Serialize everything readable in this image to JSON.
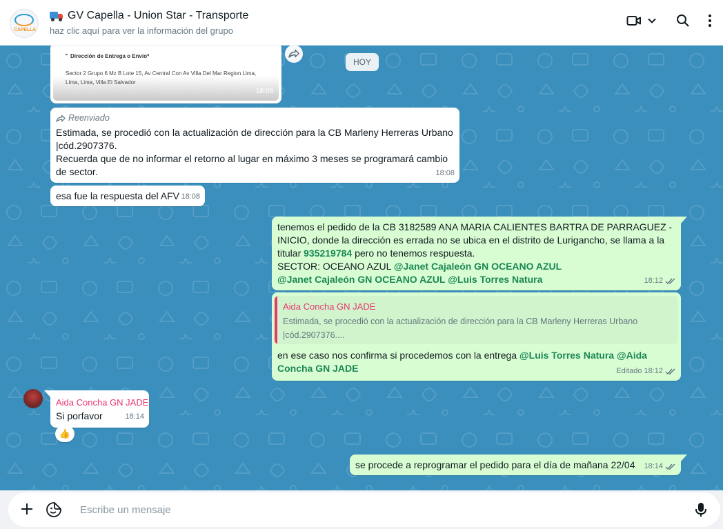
{
  "header": {
    "logo_text": "CAPELLA",
    "title": "GV Capella - Union Star - Transporte",
    "subtitle": "haz clic aquí para ver la información del grupo",
    "icons": [
      "video-call-icon",
      "chevron-down-icon",
      "search-icon",
      "menu-dots-icon"
    ]
  },
  "chat": {
    "image_message": {
      "section_heading": "Dirección de Entrega o Envío*",
      "address": "Sector 2 Grupo 6 Mz B Lote 15, Av Central Con Av Villa Del Mar Region Lima, Lima, Lima, Villa El Salvador",
      "time": "18:08"
    },
    "day_label": "HOY",
    "forwarded_message": {
      "forwarded_label": "Reenviado",
      "line1": "Estimada, se procedió con la actualización de dirección para la CB Marleny Herreras Urbano",
      "line2": "|cód.2907376.",
      "line3": "Recuerda que de no informar el retorno al lugar en máximo 3 meses se programará cambio",
      "line4": "de sector.",
      "time": "18:08"
    },
    "afv_message": {
      "text": "esa fue la respuesta del AFV",
      "time": "18:08"
    },
    "out_message_1": {
      "line1": "tenemos el pedido de la CB 3182589 ANA MARIA CALIENTES BARTRA DE PARRAGUEZ -",
      "line2": "INICIO, donde la dirección es errada no se ubica en el distrito de Lurigancho, se llama a la",
      "line3_pre": "titular ",
      "phone": "935219784",
      "line3_post": " pero no tenemos respuesta.",
      "line4_pre": "SECTOR: OCEANO AZUL ",
      "mention_1": "@Janet Cajaleón GN OCEANO AZUL",
      "mention_2": "@Janet Cajaleón GN OCEANO AZUL",
      "mention_3": "@Luis Torres Natura",
      "time": "18:12"
    },
    "out_message_2": {
      "quote_name": "Aida Concha GN JADE",
      "quote_line1": "Estimada, se procedió con la actualización de dirección para la CB Marleny Herreras Urbano",
      "quote_line2": "|cód.2907376....",
      "text_pre": "en ese caso nos confirma si procedemos con la entrega ",
      "mention_1": "@Luis Torres Natura",
      "mention_2a": "@Aida",
      "mention_2b": "Concha GN JADE",
      "edited_label": "Editado",
      "time": "18:12"
    },
    "in_message_aida": {
      "sender": "Aida Concha GN JADE",
      "text": "Si porfavor",
      "time": "18:14",
      "reaction": "👍"
    },
    "out_message_3": {
      "text": "se procede a reprogramar el pedido para el día de mañana  22/04",
      "time": "18:14"
    }
  },
  "composer": {
    "placeholder": "Escribe un mensaje",
    "icons": [
      "plus-icon",
      "sticker-icon",
      "microphone-icon"
    ]
  },
  "colors": {
    "chat_background": "#3a8fbd",
    "outgoing_bubble": "#d9fdd3",
    "incoming_bubble": "#ffffff",
    "mention": "#1b8755",
    "sender_name": "#e8376e",
    "read_ticks": "#667781"
  }
}
